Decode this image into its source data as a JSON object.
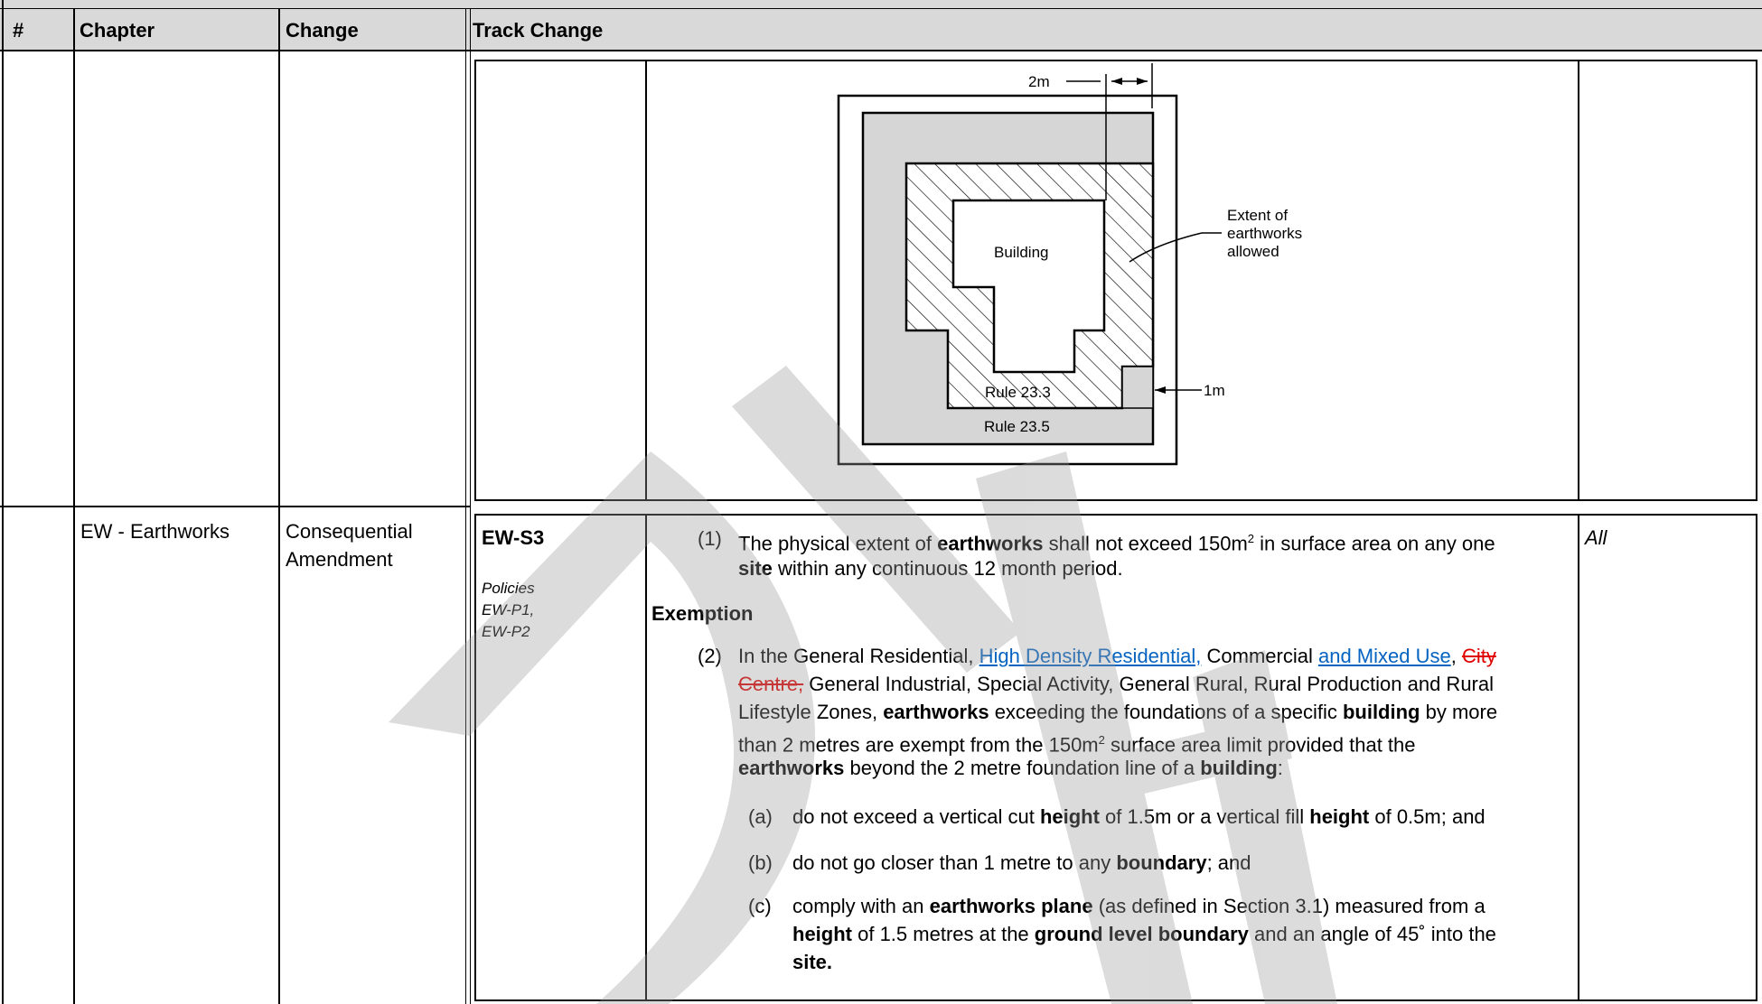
{
  "table": {
    "headers": {
      "num": "#",
      "chapter": "Chapter",
      "change": "Change",
      "track": "Track Change"
    }
  },
  "figure": {
    "dim_2m": "2m",
    "dim_1m": "1m",
    "building": "Building",
    "extent_line1": "Extent of",
    "extent_line2": "earthworks",
    "extent_line3": "allowed",
    "rule_233": "Rule 23.3",
    "rule_235": "Rule 23.5"
  },
  "row": {
    "chapter": "EW - Earthworks",
    "change_line1": "Consequential",
    "change_line2": "Amendment",
    "code": "EW-S3",
    "policies_line1": "Policies",
    "policies_line2": "EW-P1,",
    "policies_line3": "EW-P2",
    "applies": "All",
    "p1": {
      "num": "(1)",
      "t1": "The physical extent of ",
      "b1": "earthworks",
      "t2": " shall not exceed 150m",
      "sup": "2",
      "t3": " in surface area on any one",
      "b2": "site",
      "t4": " within any continuous 12 month period."
    },
    "exemption": "Exemption",
    "p2": {
      "num": "(2)",
      "t1": "In the General Residential, ",
      "ins1": "High Density Residential,",
      "t2": " Commercial ",
      "ins2": "and Mixed Use",
      "t3": ", ",
      "del1": "City",
      "del2": "Centre,",
      "t4": " General Industrial, Special Activity, General Rural, Rural Production and Rural",
      "t5": "Lifestyle Zones, ",
      "b1": "earthworks",
      "t6": " exceeding the foundations of a specific ",
      "b2": "building",
      "t7": " by more",
      "t8": "than 2 metres are exempt from the 150m",
      "sup": "2",
      "t9": " surface area limit provided that the",
      "b3": "earthworks",
      "t10": " beyond the 2 metre foundation line of a ",
      "b4": "building",
      "t11": ":"
    },
    "a": {
      "num": "(a)",
      "t1": "do not exceed a vertical cut ",
      "b1": "height",
      "t2": " of 1.5m or a vertical fill ",
      "b2": "height",
      "t3": " of 0.5m; and"
    },
    "b": {
      "num": "(b)",
      "t1": "do not go closer than 1 metre to any ",
      "b1": "boundary",
      "t2": "; and"
    },
    "c": {
      "num": "(c)",
      "t1": "comply with an ",
      "b1": "earthworks plane",
      "t2": " (as defined in Section 3.1) measured from a",
      "b2": "height",
      "t3": " of 1.5 metres at the ",
      "b3": "ground level boundary",
      "t4": " and an angle of 45˚ into the",
      "b4": "site."
    }
  }
}
